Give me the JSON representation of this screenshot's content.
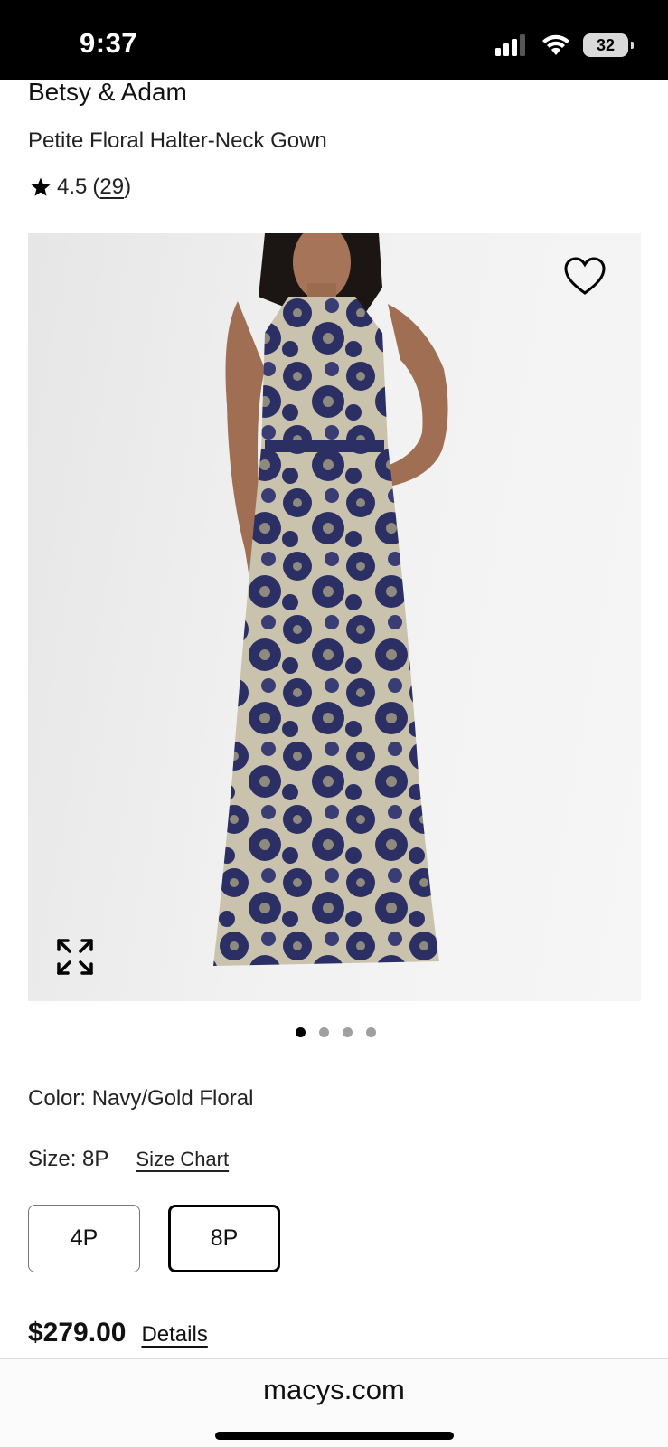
{
  "status_bar": {
    "time": "9:37",
    "battery": "32",
    "icons": [
      "cellular-signal-icon",
      "wifi-icon",
      "battery-icon"
    ]
  },
  "product": {
    "brand": "Betsy & Adam",
    "name": "Petite Floral Halter-Neck Gown",
    "rating": "4.5",
    "review_count_open": "(",
    "review_count": "29",
    "review_count_close": ")"
  },
  "gallery": {
    "image_count": 4,
    "active_index": 0,
    "icons": [
      "heart-icon",
      "expand-icon"
    ]
  },
  "color": {
    "label": "Color: Navy/Gold Floral"
  },
  "size": {
    "label": "Size: 8P",
    "chart_link": "Size Chart",
    "options": [
      {
        "label": "4P",
        "selected": false
      },
      {
        "label": "8P",
        "selected": true
      }
    ]
  },
  "price": {
    "amount": "$279.00",
    "details_link": "Details"
  },
  "browser": {
    "domain": "macys.com"
  },
  "colors": {
    "accent": "#000000",
    "dress_navy": "#2c2f63",
    "dress_gold": "#c9c3ad"
  }
}
